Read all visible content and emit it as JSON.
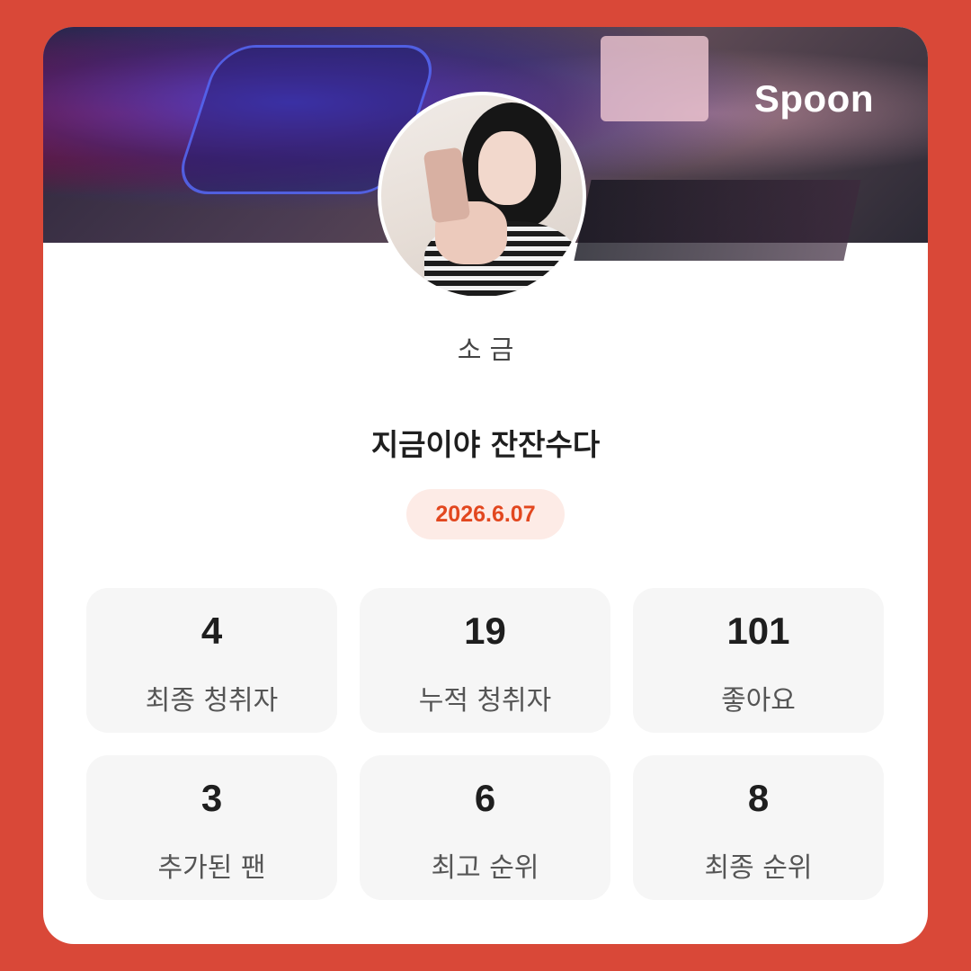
{
  "brand": {
    "logo_text": "Spoon",
    "background_color": "#d94838",
    "accent_color": "#e2471f"
  },
  "profile": {
    "host_name": "소 금"
  },
  "broadcast": {
    "title": "지금이야 잔잔수다",
    "date": "2026.6.07"
  },
  "stats": [
    {
      "value": "4",
      "label": "최종 청취자"
    },
    {
      "value": "19",
      "label": "누적 청취자"
    },
    {
      "value": "101",
      "label": "좋아요"
    },
    {
      "value": "3",
      "label": "추가된 팬"
    },
    {
      "value": "6",
      "label": "최고 순위"
    },
    {
      "value": "8",
      "label": "최종 순위"
    }
  ]
}
